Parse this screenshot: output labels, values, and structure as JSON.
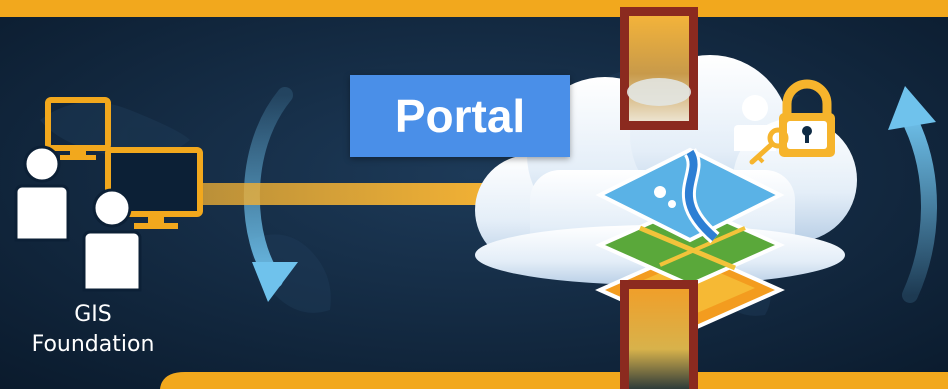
{
  "portal": {
    "label": "Portal"
  },
  "foundation": {
    "line1": "GIS",
    "line2": "Foundation"
  },
  "colors": {
    "background": "#0c2036",
    "frame": "#f2a81d",
    "portal_box": "#4a8fe8",
    "connector": "#f2b134",
    "lock": "#f6b42c",
    "handle": "#8b2a1f",
    "arrow": "#6fc2ec"
  },
  "icons": [
    "users-at-computers-icon",
    "cloud-icon",
    "map-layers-icon",
    "user-key-lock-icon",
    "cycle-arrow-icon"
  ]
}
